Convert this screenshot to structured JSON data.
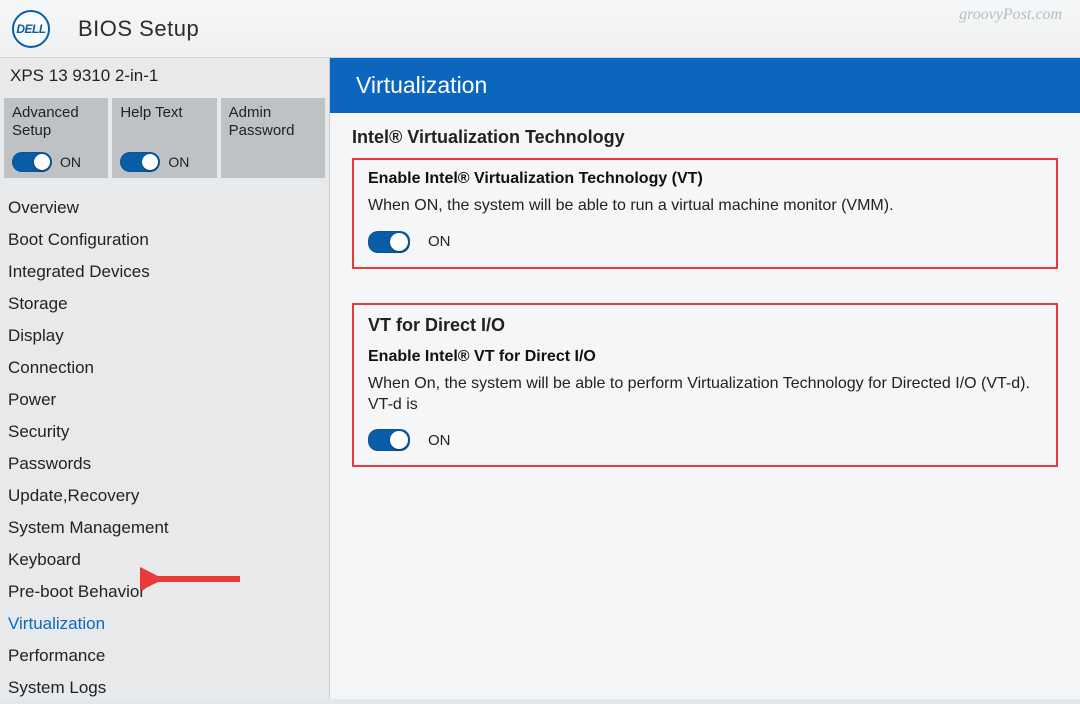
{
  "header": {
    "logo_text": "DELL",
    "title": "BIOS Setup"
  },
  "device_model": "XPS 13 9310 2-in-1",
  "sidebar_toggles": [
    {
      "label": "Advanced\nSetup",
      "state": "ON"
    },
    {
      "label": "Help Text",
      "state": "ON"
    },
    {
      "label": "Admin\nPassword",
      "state": ""
    }
  ],
  "nav_items": [
    "Overview",
    "Boot Configuration",
    "Integrated Devices",
    "Storage",
    "Display",
    "Connection",
    "Power",
    "Security",
    "Passwords",
    "Update,Recovery",
    "System Management",
    "Keyboard",
    "Pre-boot Behavior",
    "Virtualization",
    "Performance",
    "System Logs"
  ],
  "nav_active_index": 13,
  "main": {
    "section_title": "Virtualization",
    "group1_title": "Intel® Virtualization Technology",
    "setting1": {
      "name": "Enable Intel® Virtualization Technology (VT)",
      "desc": "When ON, the system will be able to run a virtual machine monitor (VMM).",
      "state": "ON"
    },
    "group2_title": "VT for Direct I/O",
    "setting2": {
      "name": "Enable Intel® VT for Direct I/O",
      "desc": "When On, the system will be able to perform Virtualization Technology for Directed I/O (VT-d). VT-d is",
      "state": "ON"
    }
  },
  "watermark": "groovyPost.com",
  "colors": {
    "accent": "#0c66bd",
    "highlight": "#e83a3a"
  }
}
